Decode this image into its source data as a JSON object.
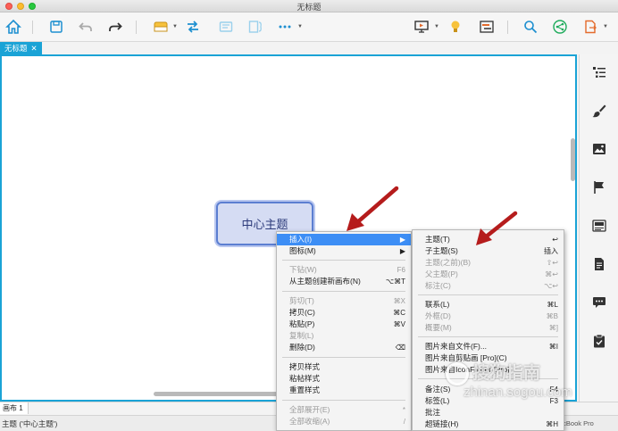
{
  "window": {
    "title": "无标题"
  },
  "tabs": [
    {
      "label": "无标题",
      "close": "✕"
    }
  ],
  "canvas": {
    "central_topic": "中心主题"
  },
  "bottombar": {
    "sheet_label": "画布 1"
  },
  "status": {
    "text": "主题 ('中心主题')",
    "device": "acBook Pro"
  },
  "context_menu": {
    "items": [
      {
        "label": "插入(I)",
        "shortcut": "▶",
        "state": "highlighted"
      },
      {
        "label": "图标(M)",
        "shortcut": "▶",
        "state": "normal"
      },
      {
        "label": "下钻(W)",
        "shortcut": "F6",
        "state": "disabled"
      },
      {
        "label": "从主题创建新画布(N)",
        "shortcut": "⌥⌘T",
        "state": "normal"
      },
      {
        "label": "剪切(T)",
        "shortcut": "⌘X",
        "state": "disabled"
      },
      {
        "label": "拷贝(C)",
        "shortcut": "⌘C",
        "state": "normal"
      },
      {
        "label": "粘贴(P)",
        "shortcut": "⌘V",
        "state": "normal"
      },
      {
        "label": "复制(L)",
        "shortcut": "",
        "state": "disabled"
      },
      {
        "label": "删除(D)",
        "shortcut": "⌫",
        "state": "normal"
      },
      {
        "label": "拷贝样式",
        "shortcut": "",
        "state": "normal"
      },
      {
        "label": "粘帖样式",
        "shortcut": "",
        "state": "normal"
      },
      {
        "label": "重置样式",
        "shortcut": "",
        "state": "normal"
      },
      {
        "label": "全部展开(E)",
        "shortcut": "*",
        "state": "disabled"
      },
      {
        "label": "全部收缩(A)",
        "shortcut": "/",
        "state": "disabled"
      }
    ]
  },
  "submenu": {
    "items": [
      {
        "label": "主题(T)",
        "shortcut": "↩",
        "state": "normal"
      },
      {
        "label": "子主题(S)",
        "shortcut": "插入",
        "state": "normal"
      },
      {
        "label": "主题(之前)(B)",
        "shortcut": "⇧↩",
        "state": "disabled"
      },
      {
        "label": "父主题(P)",
        "shortcut": "⌘↩",
        "state": "disabled"
      },
      {
        "label": "标注(C)",
        "shortcut": "⌥↩",
        "state": "disabled"
      },
      {
        "label": "联系(L)",
        "shortcut": "⌘L",
        "state": "normal"
      },
      {
        "label": "外框(D)",
        "shortcut": "⌘B",
        "state": "disabled"
      },
      {
        "label": "概要(M)",
        "shortcut": "⌘]",
        "state": "disabled"
      },
      {
        "label": "图片来自文件(F)...",
        "shortcut": "⌘I",
        "state": "normal"
      },
      {
        "label": "图片来自剪贴画 [Pro](C)",
        "shortcut": "",
        "state": "normal"
      },
      {
        "label": "图片来自IconFinder [Pro]",
        "shortcut": "",
        "state": "normal"
      },
      {
        "label": "备注(S)",
        "shortcut": "F4",
        "state": "normal"
      },
      {
        "label": "标签(L)",
        "shortcut": "F3",
        "state": "normal"
      },
      {
        "label": "批注",
        "shortcut": "",
        "state": "normal"
      },
      {
        "label": "超链接(H)",
        "shortcut": "⌘H",
        "state": "normal"
      }
    ]
  },
  "watermark": {
    "line1": "搜狗指南",
    "line2": "zhinan.sogou.com"
  },
  "colors": {
    "accent": "#1aa3d6",
    "topic_border": "#5c7fd1",
    "topic_fill": "#d5dcf3",
    "highlight": "#3d8ef5",
    "annotation_arrow": "#b51c1c"
  }
}
